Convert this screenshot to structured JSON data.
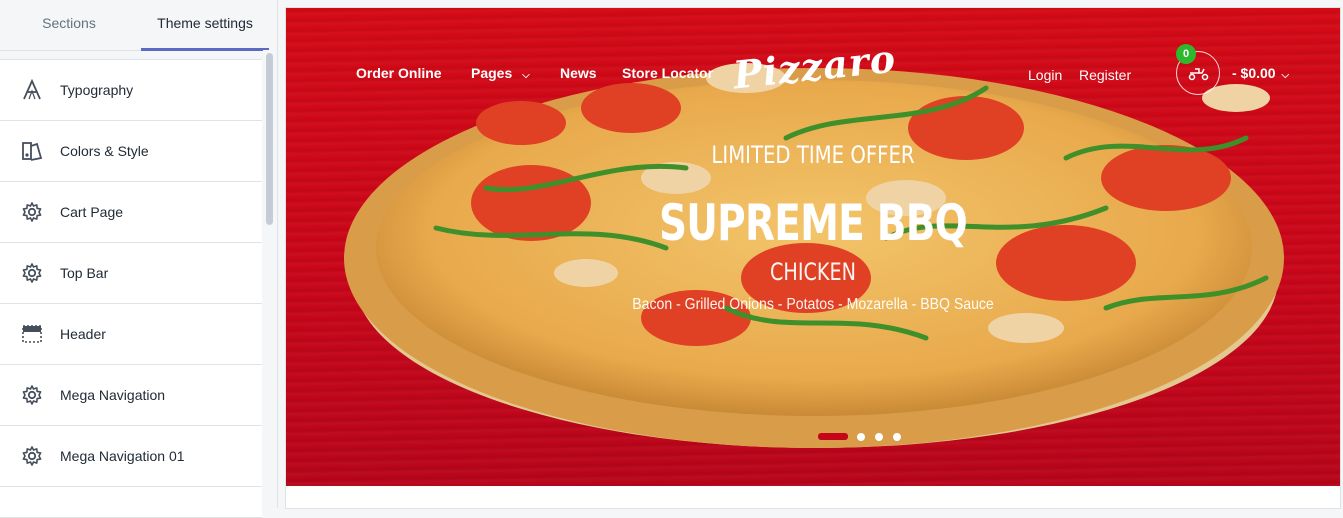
{
  "sidebar": {
    "tabs": [
      {
        "label": "Sections",
        "active": false
      },
      {
        "label": "Theme settings",
        "active": true
      }
    ],
    "items": [
      {
        "label": "Typography",
        "icon": "typography-icon"
      },
      {
        "label": "Colors & Style",
        "icon": "color-palette-icon"
      },
      {
        "label": "Cart Page",
        "icon": "gear-icon"
      },
      {
        "label": "Top Bar",
        "icon": "gear-icon"
      },
      {
        "label": "Header",
        "icon": "header-layout-icon"
      },
      {
        "label": "Mega Navigation",
        "icon": "gear-icon"
      },
      {
        "label": "Mega Navigation 01",
        "icon": "gear-icon"
      }
    ]
  },
  "store": {
    "nav": [
      {
        "label": "Order Online"
      },
      {
        "label": "Pages",
        "has_dropdown": true
      },
      {
        "label": "News"
      },
      {
        "label": "Store Locator"
      }
    ],
    "logo": "Pizzaro",
    "account": {
      "login": "Login",
      "register": "Register"
    },
    "cart": {
      "count": "0",
      "total": "- $0.00",
      "icon": "scooter-icon"
    }
  },
  "slider": {
    "offer": "LIMITED TIME OFFER",
    "headline": "SUPREME BBQ",
    "subheadline": "CHICKEN",
    "ingredients": "Bacon - Grilled Onions - Potatos - Mozarella - BBQ Sauce",
    "slide_count": 4,
    "active_slide": 1
  },
  "colors": {
    "hero_red": "#c9061a",
    "tab_accent": "#5c6ac4",
    "badge_green": "#2eb82e"
  }
}
